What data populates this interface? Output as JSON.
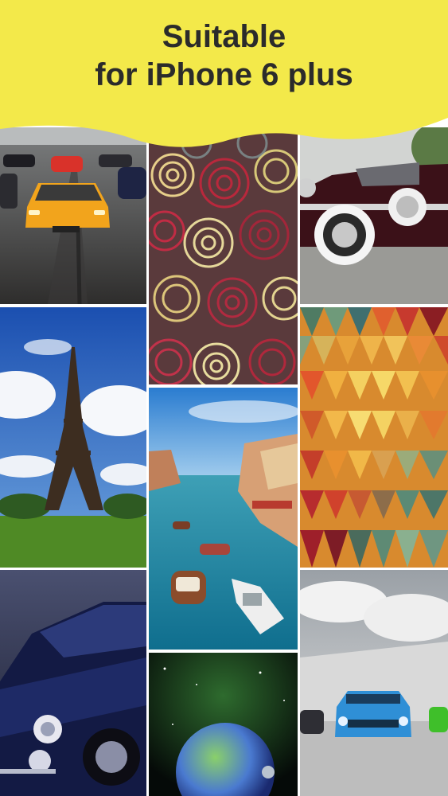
{
  "banner": {
    "line1": "Suitable",
    "line2": "for iPhone 6 plus",
    "background": "#f3e94a"
  },
  "tiles": [
    {
      "name": "wallpaper-sports-cars",
      "column": 1,
      "row": 1
    },
    {
      "name": "wallpaper-swirl-pattern",
      "column": 2,
      "row": 1
    },
    {
      "name": "wallpaper-vintage-car",
      "column": 3,
      "row": 1
    },
    {
      "name": "wallpaper-eiffel-tower",
      "column": 1,
      "row": 2
    },
    {
      "name": "wallpaper-venice-canal",
      "column": 2,
      "row": 2
    },
    {
      "name": "wallpaper-geometric-triangles",
      "column": 3,
      "row": 2
    },
    {
      "name": "wallpaper-muscle-car",
      "column": 1,
      "row": 3
    },
    {
      "name": "wallpaper-space-planet",
      "column": 2,
      "row": 3
    },
    {
      "name": "wallpaper-blue-challenger",
      "column": 3,
      "row": 3
    }
  ]
}
